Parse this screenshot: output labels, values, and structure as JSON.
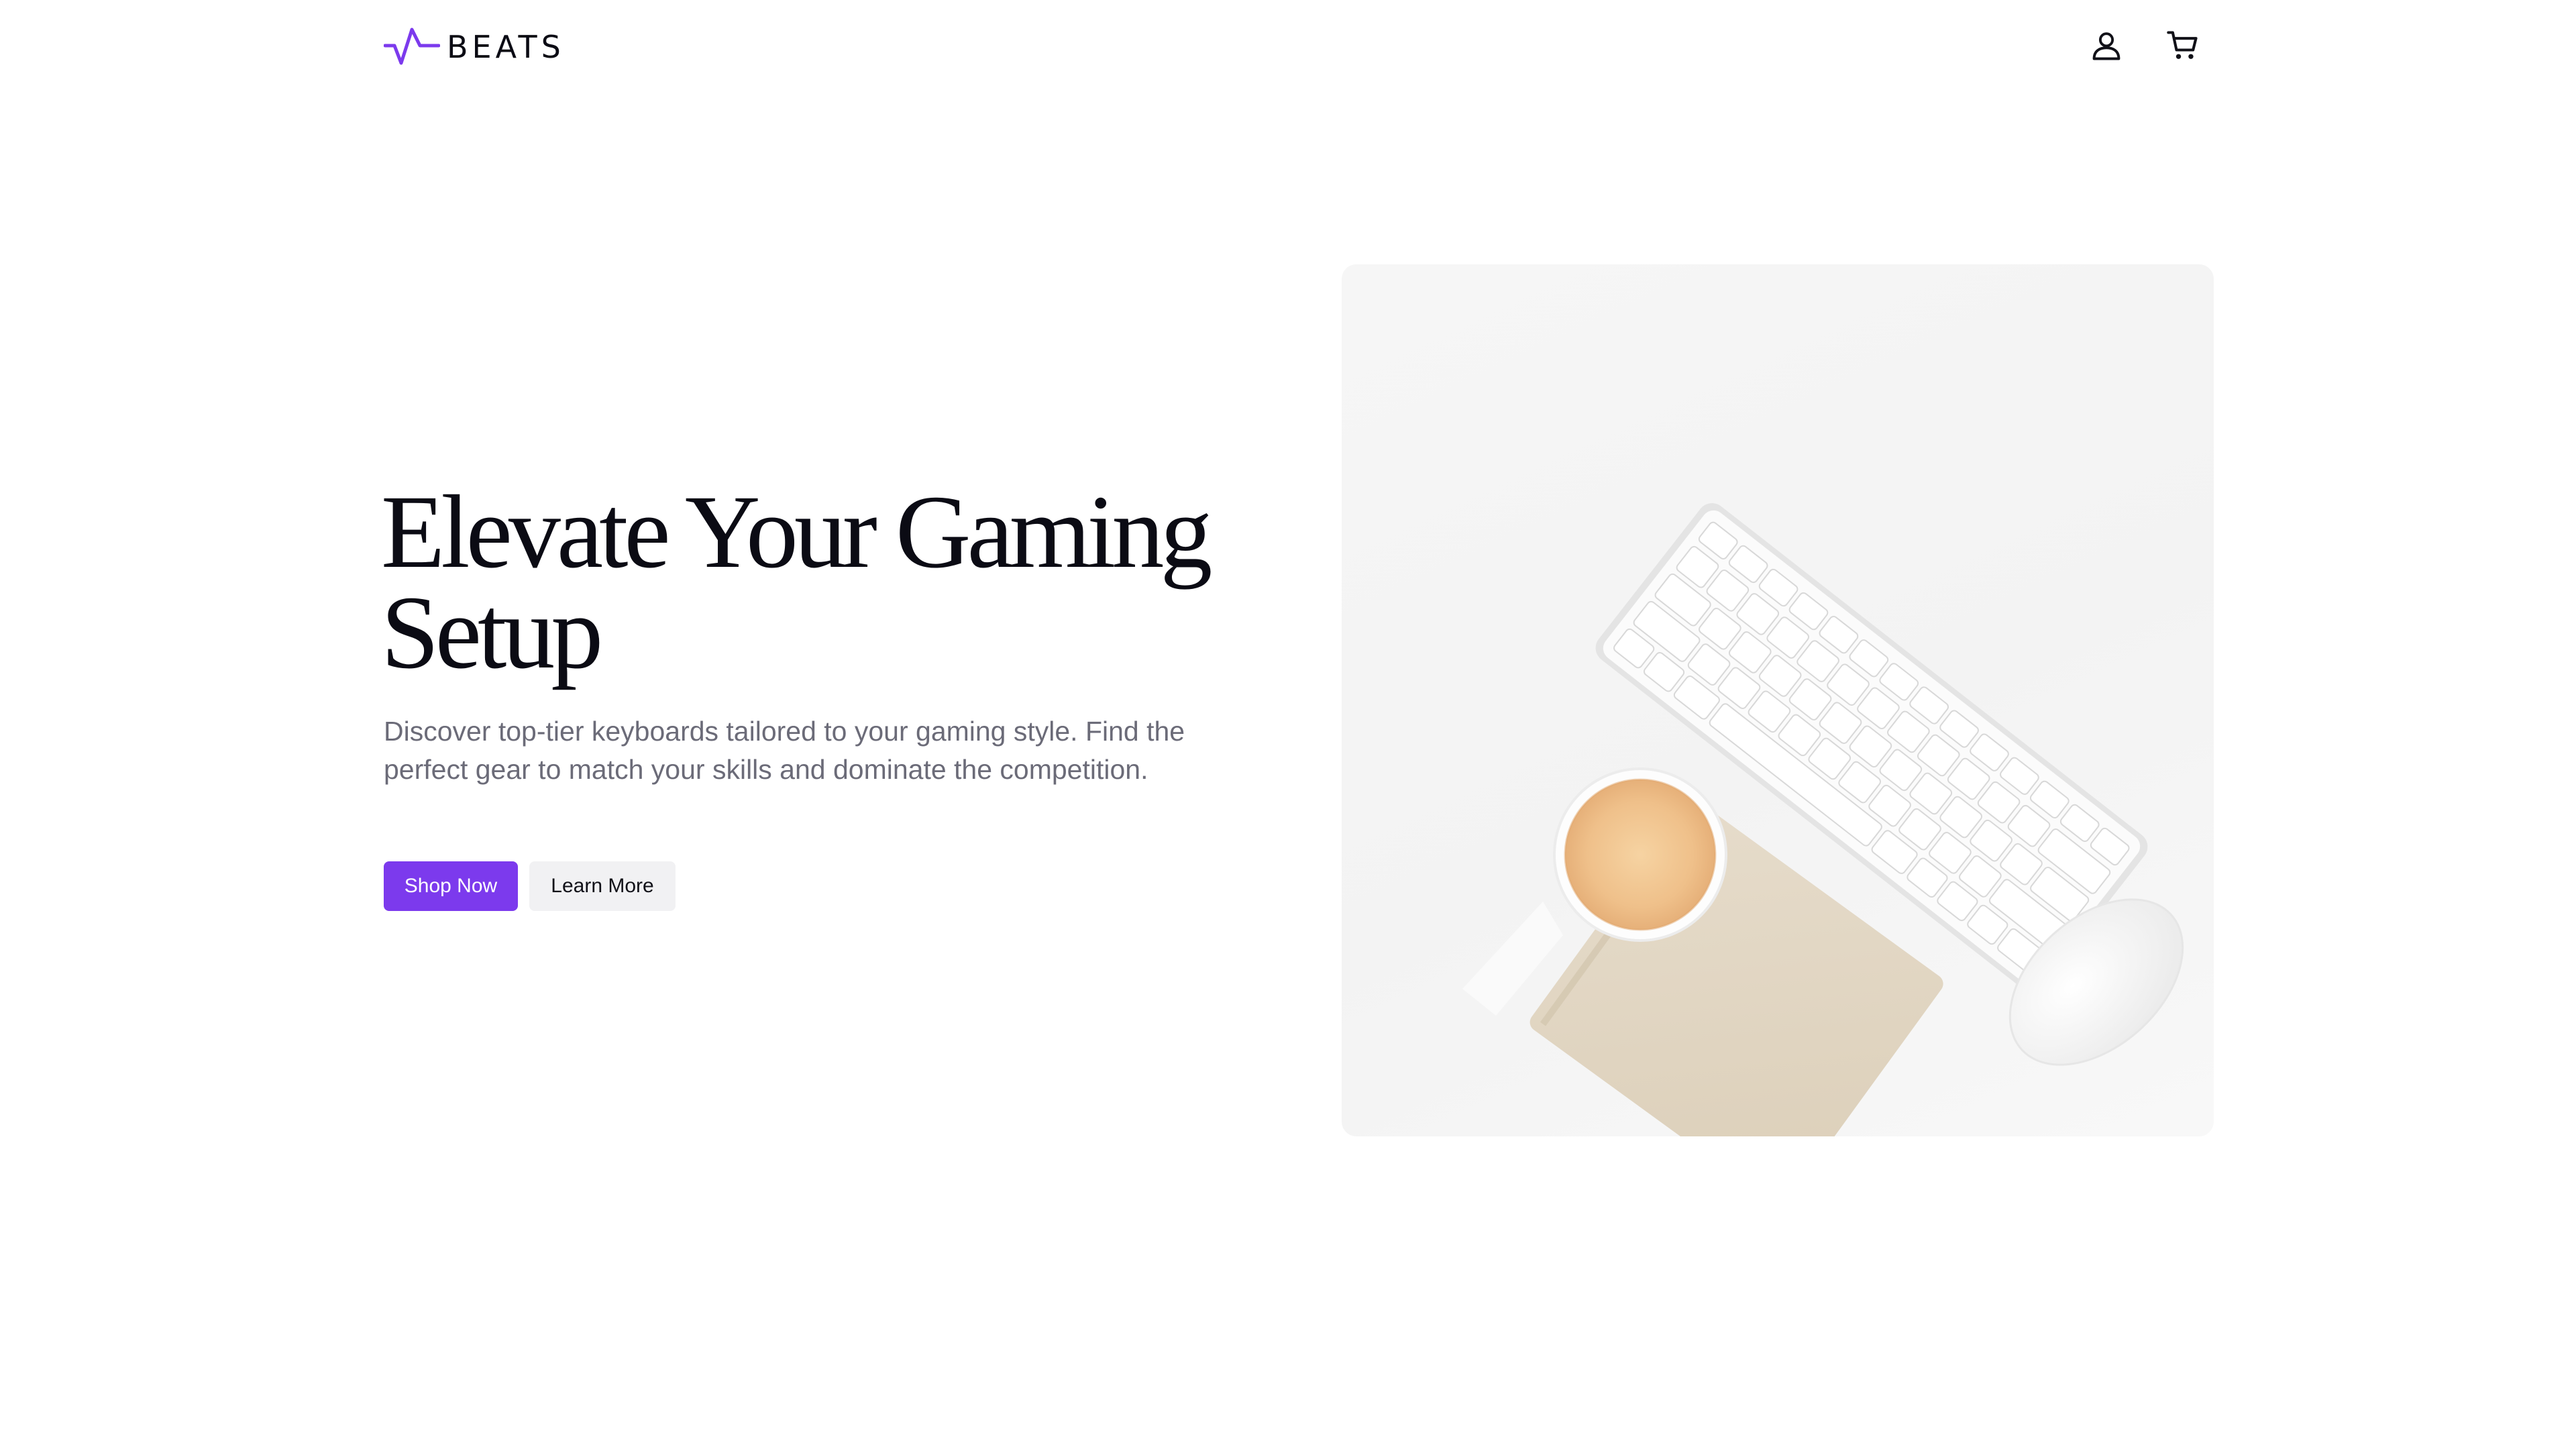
{
  "header": {
    "logo_text": "BEATS",
    "logo_icon": "pulse-wave-icon",
    "account_icon": "user-icon",
    "cart_icon": "shopping-cart-icon"
  },
  "hero": {
    "title": "Elevate Your Gaming Setup",
    "subtitle": "Discover top-tier keyboards tailored to your gaming style. Find the perfect gear to match your skills and dominate the competition.",
    "primary_button": "Shop Now",
    "secondary_button": "Learn More",
    "image_subject": "white keyboard, coffee cup, mouse and notebook on white desk"
  },
  "colors": {
    "accent": "#7c3aed",
    "text": "#0b0b14",
    "muted_text": "#6b6b78",
    "secondary_button_bg": "#f1f1f3"
  }
}
